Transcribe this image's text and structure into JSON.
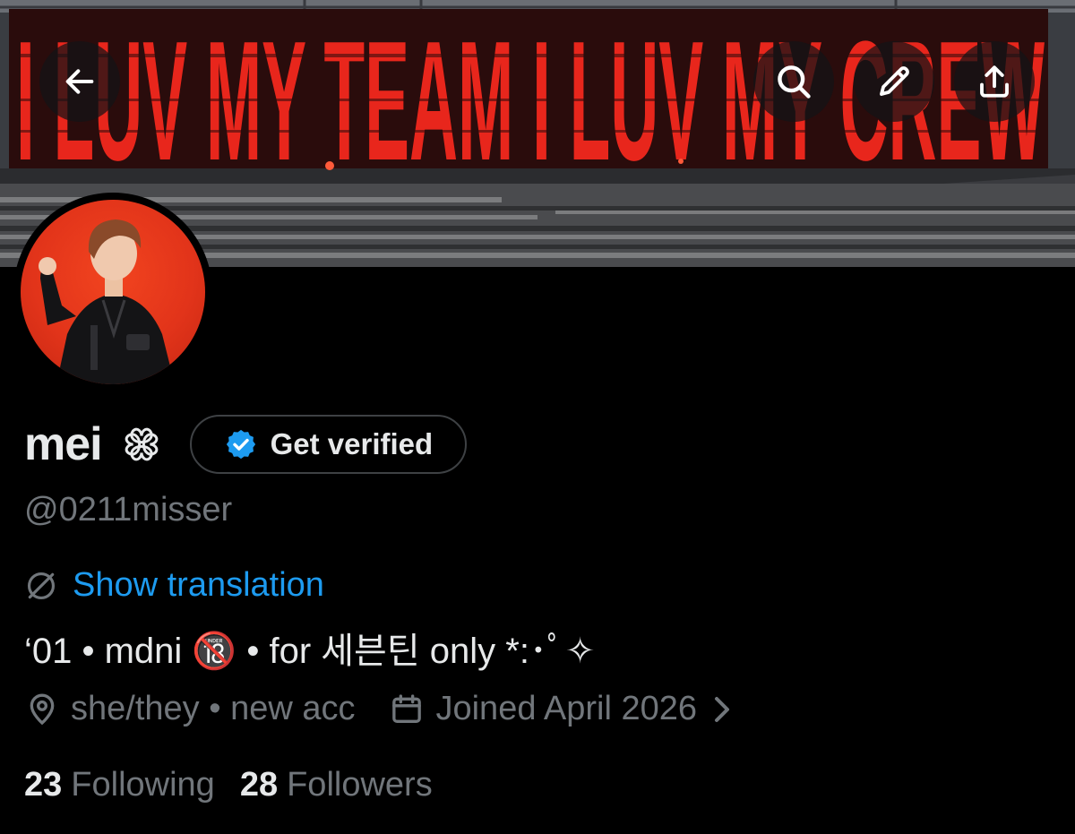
{
  "banner": {
    "sign_text": "I LUV MY TEAM I LUV MY CREW",
    "sign_color": "#e8261c"
  },
  "header_actions": {
    "back": "back-arrow-icon",
    "search": "search-icon",
    "edit": "pencil-icon",
    "share": "share-icon"
  },
  "profile": {
    "display_name": "mei",
    "name_emoji": "clover-outline-icon",
    "get_verified_label": "Get verified",
    "handle": "@0211misser",
    "translation_label": "Show translation",
    "bio": "‘01 • mdni 🔞 • for 세븐틴 only *:･ﾟ✧",
    "location": "she/they • new acc",
    "joined": "Joined April 2026",
    "following_count": "23",
    "following_label": "Following",
    "followers_count": "28",
    "followers_label": "Followers"
  },
  "colors": {
    "background": "#000000",
    "text_primary": "#e7e9ea",
    "text_secondary": "#71767b",
    "link": "#1d9bf0",
    "verified_badge": "#1d9bf0",
    "avatar_background": "#e2341a"
  }
}
